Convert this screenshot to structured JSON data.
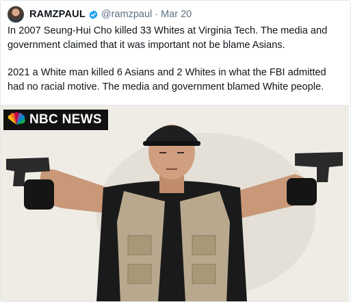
{
  "tweet": {
    "display_name": "RAMZPAUL",
    "handle": "@ramzpaul",
    "separator": "·",
    "date": "Mar 20",
    "paragraphs": [
      "In 2007 Seung-Hui Cho killed 33 Whites at Virginia Tech. The media and government claimed that it was important not be blame Asians.",
      "2021 a White man killed 6 Asians and 2 Whites in what the FBI admitted had no racial motive. The media and government blamed White people."
    ]
  },
  "media": {
    "logo_text": "NBC NEWS",
    "icons": [
      "nbc-peacock-icon"
    ]
  },
  "colors": {
    "verified": "#1da1f2",
    "secondary_text": "#5b7083",
    "primary_text": "#0f1419",
    "border": "#e1e8ed"
  },
  "icons": [
    "verified-badge-icon"
  ]
}
